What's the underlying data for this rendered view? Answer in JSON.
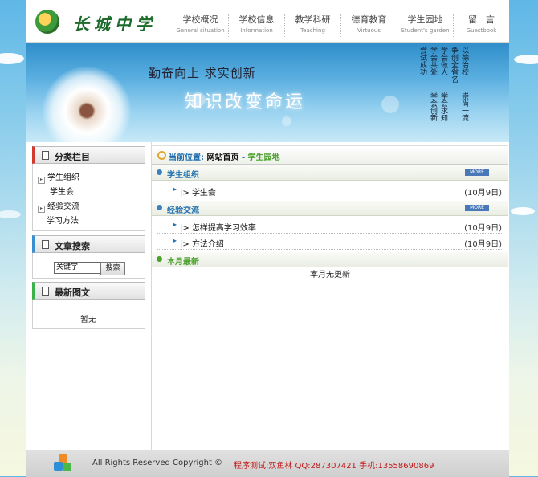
{
  "site": {
    "name": "长城中学"
  },
  "nav": [
    {
      "cn": "学校概况",
      "en": "General situation"
    },
    {
      "cn": "学校信息",
      "en": "Information"
    },
    {
      "cn": "教学科研",
      "en": "Teaching"
    },
    {
      "cn": "德育教育",
      "en": "Virtuous"
    },
    {
      "cn": "学生园地",
      "en": "Student's garden"
    },
    {
      "cn": "留　言",
      "en": "Guestbook"
    }
  ],
  "banner": {
    "slogan_top": "勤奋向上 求实创新",
    "slogan_main": "知识改变命运",
    "poem_columns": [
      "以德治校",
      "争创全省名",
      "学会做人",
      "学会共处",
      "尝试成功",
      "崇尚一流",
      "学会求知",
      "学会创新"
    ]
  },
  "sidebar": {
    "category": {
      "title": "分类栏目",
      "items": [
        {
          "label": "学生组织",
          "expandable": true
        },
        {
          "label": "学生会",
          "expandable": false
        },
        {
          "label": "经验交流",
          "expandable": true
        },
        {
          "label": "学习方法",
          "expandable": false
        }
      ]
    },
    "search": {
      "title": "文章搜索",
      "input_value": "关键字",
      "button_label": "搜索"
    },
    "latest_images": {
      "title": "最新图文",
      "empty_text": "暂无"
    }
  },
  "main": {
    "breadcrumb": {
      "label": "当前位置:",
      "home": "网站首页",
      "separator": " - ",
      "current": "学生园地"
    },
    "sections": [
      {
        "title": "学生组织",
        "more": "MORE",
        "rows": [
          {
            "prefix": "|>",
            "title": "学生会",
            "date": "(10月9日)"
          }
        ]
      },
      {
        "title": "经验交流",
        "more": "MORE",
        "rows": [
          {
            "prefix": "|>",
            "title": "怎样提高学习效率",
            "date": "(10月9日)"
          },
          {
            "prefix": "|>",
            "title": "方法介绍",
            "date": "(10月9日)"
          }
        ]
      }
    ],
    "monthly": {
      "title": "本月最新",
      "empty_text": "本月无更新"
    }
  },
  "footer": {
    "copyright": "All Rights Reserved Copyright ©",
    "contact": "程序测试:双鱼林  QQ:287307421  手机:13558690869"
  },
  "colors": {
    "accent_blue": "#1f6fae",
    "accent_green": "#4aa12c",
    "footer_red": "#c21b1b",
    "category_bar_red": "#d23a2e"
  }
}
